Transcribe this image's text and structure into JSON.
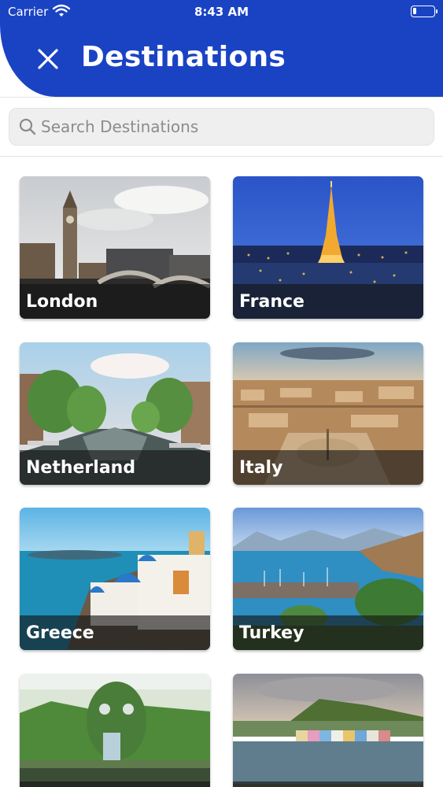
{
  "status_bar": {
    "carrier": "Carrier",
    "time": "8:43 AM"
  },
  "header": {
    "title": "Destinations",
    "close_icon": "close-icon",
    "background": "#1a43c4"
  },
  "search": {
    "placeholder": "Search Destinations",
    "value": "",
    "icon": "search-icon"
  },
  "destinations": [
    {
      "name": "London"
    },
    {
      "name": "France"
    },
    {
      "name": "Netherland"
    },
    {
      "name": "Italy"
    },
    {
      "name": "Greece"
    },
    {
      "name": "Turkey"
    },
    {
      "name": ""
    },
    {
      "name": ""
    }
  ]
}
